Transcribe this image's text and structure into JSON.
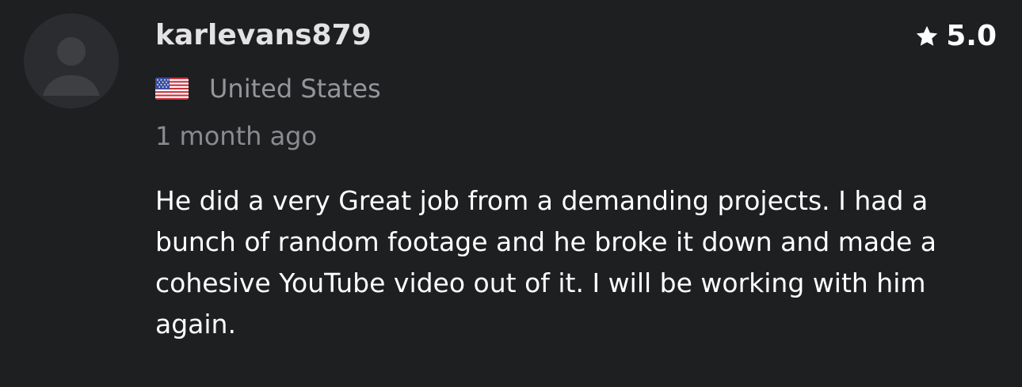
{
  "review": {
    "username": "karlevans879",
    "rating": "5.0",
    "country": {
      "flag_icon": "us-flag-icon",
      "name": "United States"
    },
    "timestamp": "1 month ago",
    "text": "He did a very Great job from a demanding projects. I had a bunch of random footage and he broke it down and made a cohesive YouTube video out of it. I will be working with him again."
  },
  "icons": {
    "avatar": "user-placeholder-icon",
    "rating": "star-icon"
  },
  "colors": {
    "background": "#1e1f21",
    "username": "#e3e3e5",
    "secondary_text": "#95969b",
    "body_text": "#ffffff"
  }
}
